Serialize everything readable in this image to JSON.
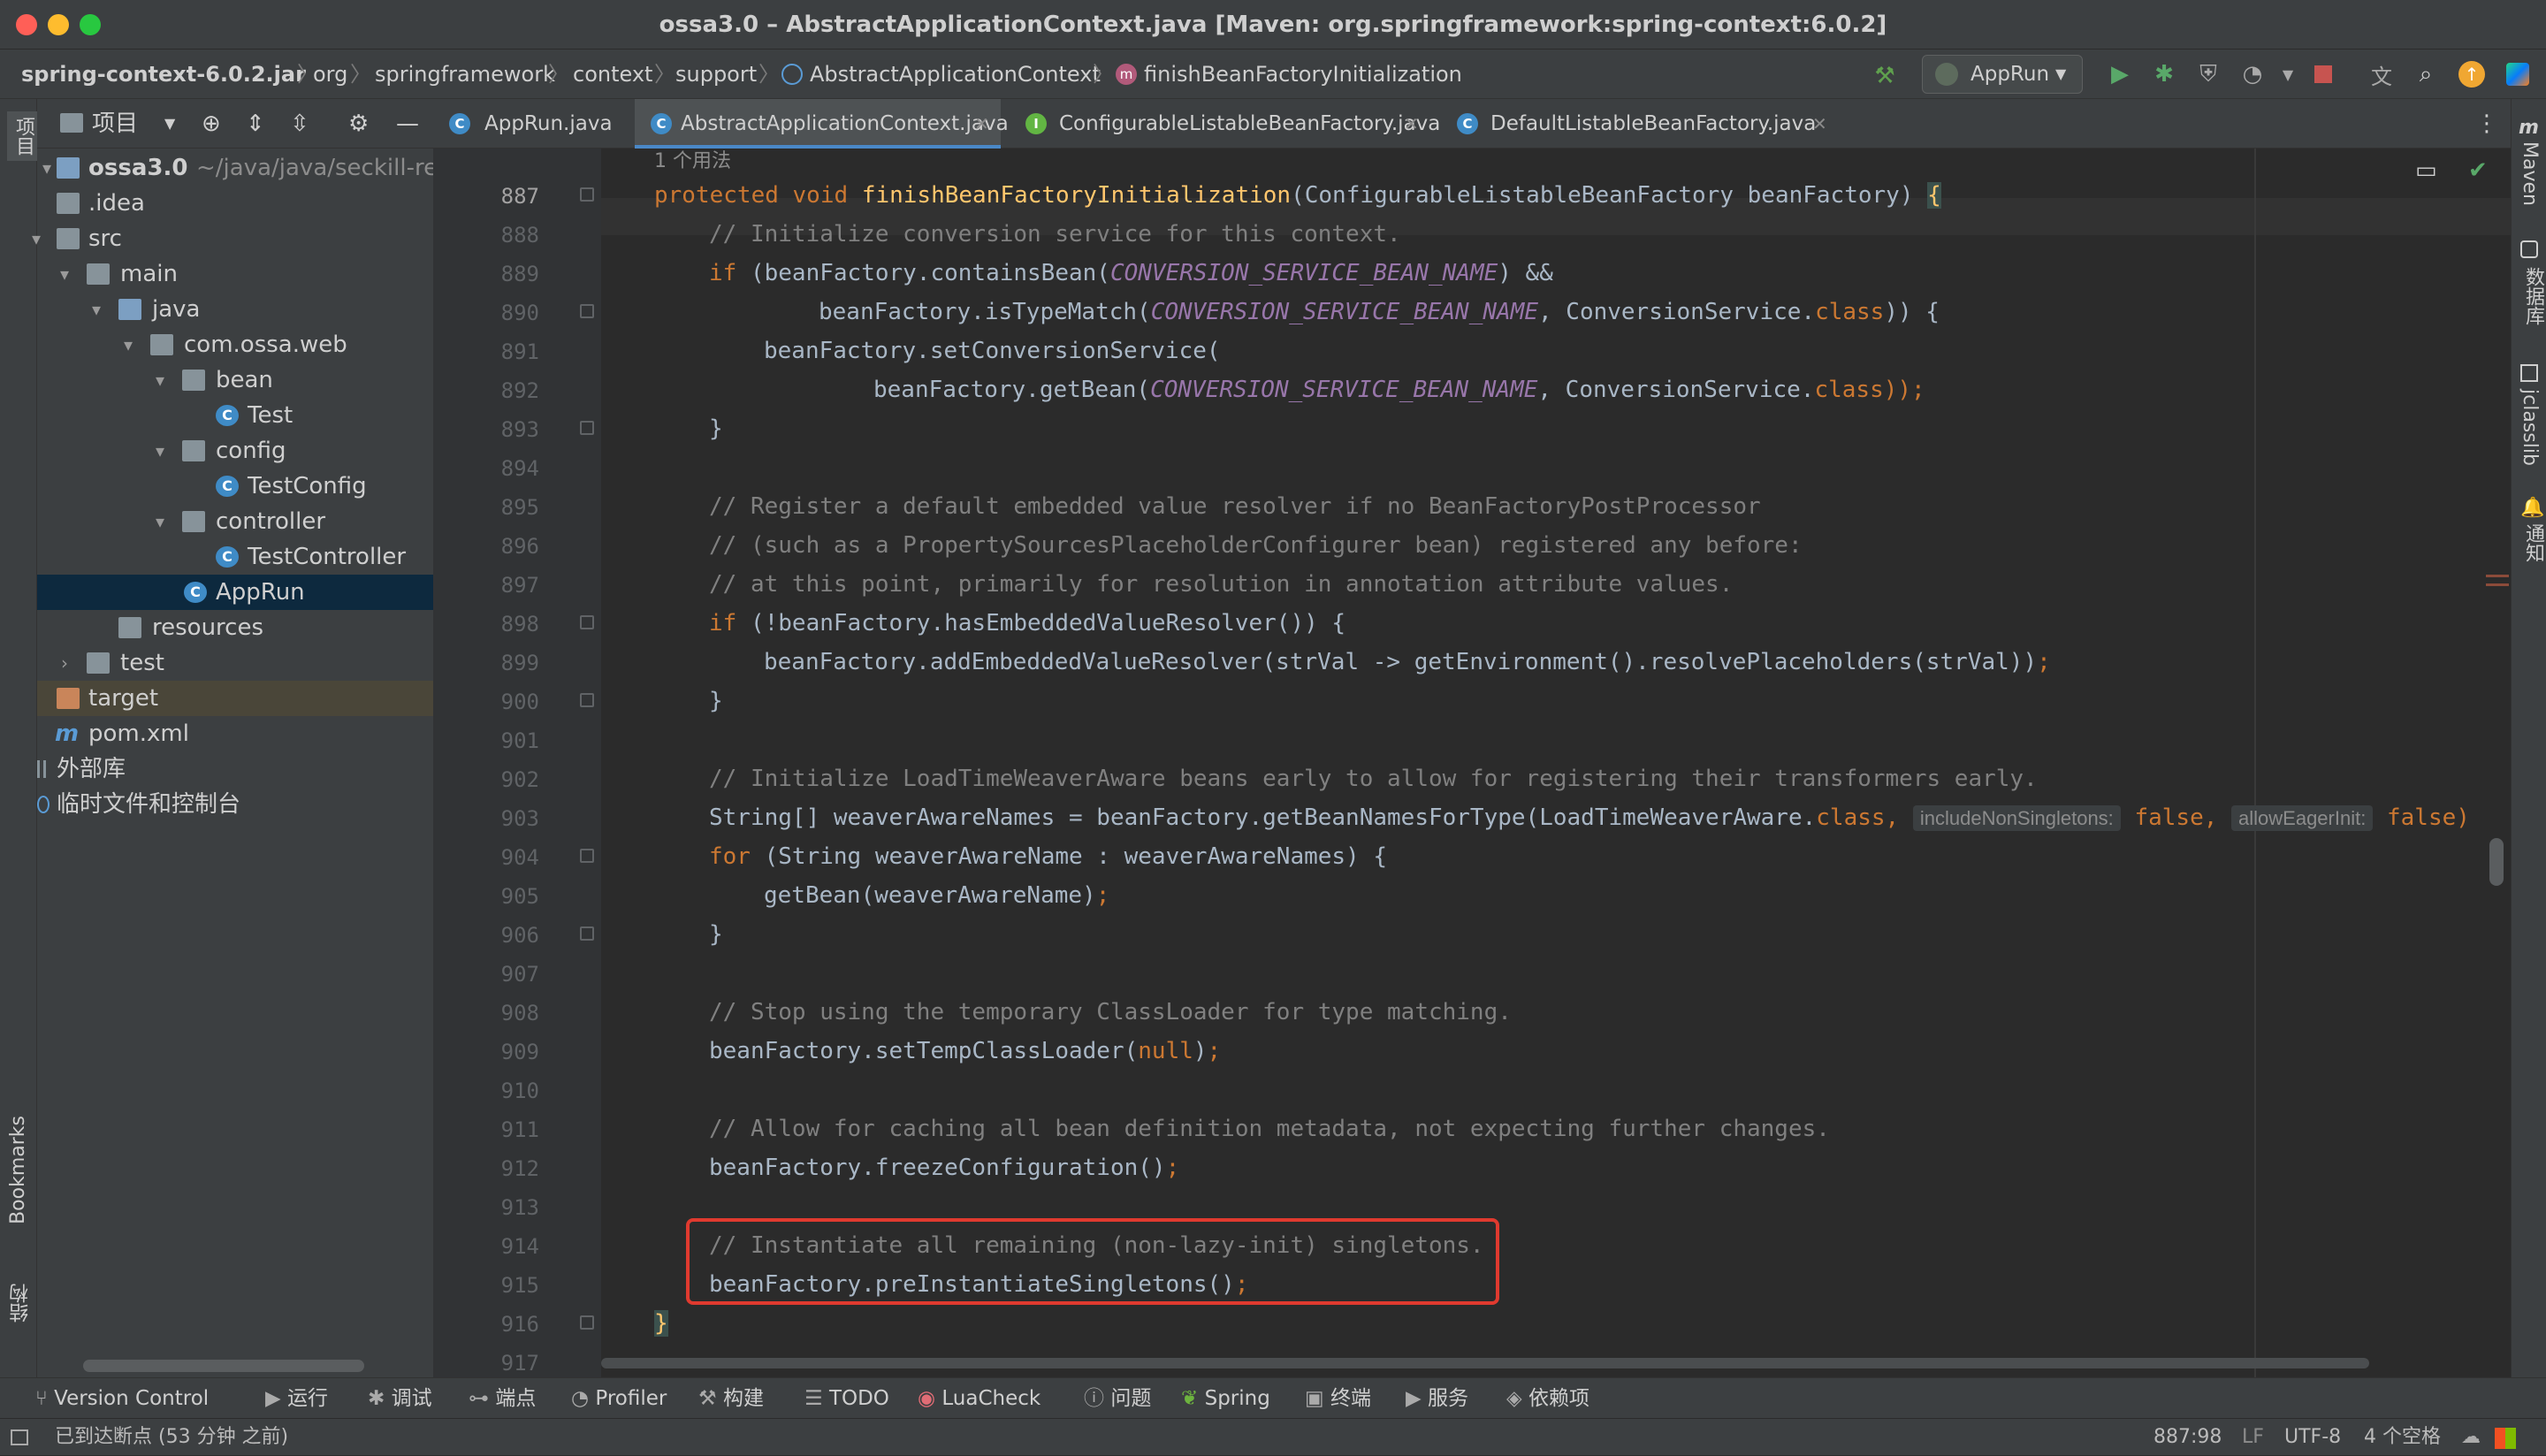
{
  "window": {
    "title": "ossa3.0 – AbstractApplicationContext.java [Maven: org.springframework:spring-context:6.0.2]"
  },
  "breadcrumb": [
    "spring-context-6.0.2.jar",
    "org",
    "springframework",
    "context",
    "support",
    "AbstractApplicationContext",
    "finishBeanFactoryInitialization"
  ],
  "toolbar": {
    "run_config": "AppRun"
  },
  "left_strip": {
    "project_label": "项目",
    "bookmarks_label": "Bookmarks",
    "structure_label": "结构"
  },
  "project_panel": {
    "title": "项目",
    "root_name": "ossa3.0",
    "root_path": "~/java/java/seckill-redis/o",
    "tree": [
      ".idea",
      "src",
      "main",
      "java",
      "com.ossa.web",
      "bean",
      "Test",
      "config",
      "TestConfig",
      "controller",
      "TestController",
      "AppRun",
      "resources",
      "test",
      "target",
      "pom.xml",
      "外部库",
      "临时文件和控制台"
    ]
  },
  "tabs": [
    "AppRun.java",
    "AbstractApplicationContext.java",
    "ConfigurableListableBeanFactory.java",
    "DefaultListableBeanFactory.java"
  ],
  "editor": {
    "usages_hint": "1 个用法",
    "line_numbers": [
      "887",
      "888",
      "889",
      "890",
      "891",
      "892",
      "893",
      "894",
      "895",
      "896",
      "897",
      "898",
      "899",
      "900",
      "901",
      "902",
      "903",
      "904",
      "905",
      "906",
      "907",
      "908",
      "909",
      "910",
      "911",
      "912",
      "913",
      "914",
      "915",
      "916",
      "917"
    ],
    "code": {
      "l887_kw": "protected void ",
      "l887_fn": "finishBeanFactoryInitialization",
      "l887_rest": "(ConfigurableListableBeanFactory beanFactory) ",
      "l887_brace": "{",
      "l888": "// Initialize conversion service for this context.",
      "l889_kw": "if",
      "l889_a": " (beanFactory.containsBean(",
      "l889_c": "CONVERSION_SERVICE_BEAN_NAME",
      "l889_b": ") &&",
      "l890_a": "beanFactory.isTypeMatch(",
      "l890_c": "CONVERSION_SERVICE_BEAN_NAME",
      "l890_b": ", ConversionService.",
      "l890_kw": "class",
      "l890_d": ")) {",
      "l891": "beanFactory.setConversionService(",
      "l892_a": "beanFactory.getBean(",
      "l892_c": "CONVERSION_SERVICE_BEAN_NAME",
      "l892_b": ", ConversionService.",
      "l892_kw": "class",
      "l892_d": "));",
      "l893": "}",
      "l895": "// Register a default embedded value resolver if no BeanFactoryPostProcessor",
      "l896": "// (such as a PropertySourcesPlaceholderConfigurer bean) registered any before:",
      "l897": "// at this point, primarily for resolution in annotation attribute values.",
      "l898_kw": "if",
      "l898_a": " (!beanFactory.hasEmbeddedValueResolver()) {",
      "l899_a": "beanFactory.addEmbeddedValueResolver(strVal -> getEnvironment().resolvePlaceholders(strVal))",
      "l899_semi": ";",
      "l900": "}",
      "l902": "// Initialize LoadTimeWeaverAware beans early to allow for registering their transformers early.",
      "l903_a": "String[] weaverAwareNames = beanFactory.getBeanNamesForType(LoadTimeWeaverAware.",
      "l903_kw": "class",
      "l903_comma": ", ",
      "l903_hint1": "includeNonSingletons:",
      "l903_v1": " false, ",
      "l903_hint2": "allowEagerInit:",
      "l903_v2": " false)",
      "l904_kw": "for",
      "l904_a": " (String weaverAwareName : weaverAwareNames) {",
      "l905_a": "getBean(weaverAwareName)",
      "l905_semi": ";",
      "l906": "}",
      "l908": "// Stop using the temporary ClassLoader for type matching.",
      "l909_a": "beanFactory.setTempClassLoader(",
      "l909_kw": "null",
      "l909_b": ")",
      "l909_semi": ";",
      "l911": "// Allow for caching all bean definition metadata, not expecting further changes.",
      "l912_a": "beanFactory.freezeConfiguration()",
      "l912_semi": ";",
      "l914": "// Instantiate all remaining (non-lazy-init) singletons.",
      "l915_a": "beanFactory.preInstantiateSingletons()",
      "l915_semi": ";",
      "l916": "}"
    }
  },
  "right_strip": [
    "Maven",
    "数据库",
    "jclasslib",
    "通知"
  ],
  "toolwindows": [
    "Version Control",
    "运行",
    "调试",
    "端点",
    "Profiler",
    "构建",
    "TODO",
    "LuaCheck",
    "问题",
    "Spring",
    "终端",
    "服务",
    "依赖项"
  ],
  "status": {
    "message": "已到达断点 (53 分钟 之前)",
    "position": "887:98",
    "line_sep": "LF",
    "encoding": "UTF-8",
    "indent": "4 个空格"
  },
  "colors": {
    "accent_red": "#e03a2f",
    "keyword": "#cc7832",
    "function": "#ffc66d",
    "comment": "#808080",
    "constant": "#9876aa"
  }
}
